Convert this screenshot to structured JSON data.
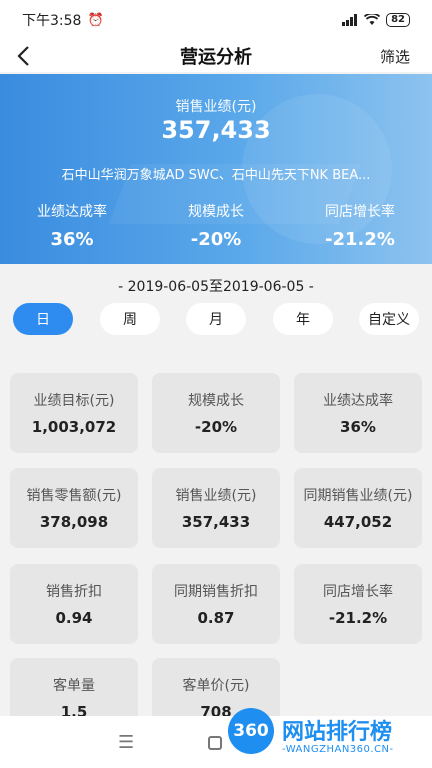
{
  "status": {
    "time": "下午3:58",
    "battery": "82"
  },
  "nav": {
    "title": "营运分析",
    "filter": "筛选"
  },
  "hero": {
    "sales_label": "销售业绩(元)",
    "sales_value": "357,433",
    "stores": "石中山华润万象城AD SWC、石中山先天下NK BEA...",
    "stats": [
      {
        "label": "业绩达成率",
        "value": "36%"
      },
      {
        "label": "规模成长",
        "value": "-20%"
      },
      {
        "label": "同店增长率",
        "value": "-21.2%"
      }
    ]
  },
  "date_range": "- 2019-06-05至2019-06-05 -",
  "periods": [
    "日",
    "周",
    "月",
    "年",
    "自定义"
  ],
  "active_period": "日",
  "cards": [
    {
      "label": "业绩目标(元)",
      "value": "1,003,072"
    },
    {
      "label": "规模成长",
      "value": "-20%"
    },
    {
      "label": "业绩达成率",
      "value": "36%"
    },
    {
      "label": "销售零售额(元)",
      "value": "378,098"
    },
    {
      "label": "销售业绩(元)",
      "value": "357,433"
    },
    {
      "label": "同期销售业绩(元)",
      "value": "447,052"
    },
    {
      "label": "销售折扣",
      "value": "0.94"
    },
    {
      "label": "同期销售折扣",
      "value": "0.87"
    },
    {
      "label": "同店增长率",
      "value": "-21.2%"
    },
    {
      "label": "客单量",
      "value": "1.5"
    },
    {
      "label": "客单价(元)",
      "value": "708"
    }
  ],
  "watermark": {
    "badge": "360",
    "name": "网站排行榜",
    "url": "WANGZHAN360.CN"
  }
}
